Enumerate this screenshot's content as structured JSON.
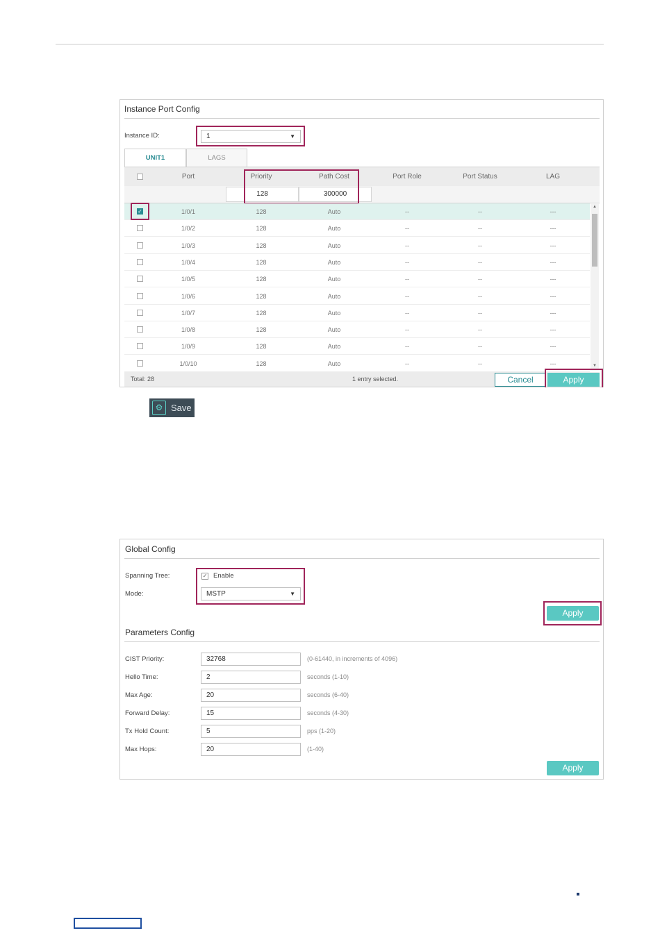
{
  "instance_port_config": {
    "title": "Instance Port Config",
    "instance_id_label": "Instance ID:",
    "instance_id_value": "1",
    "tabs": [
      "UNIT1",
      "LAGS"
    ],
    "columns": [
      "Port",
      "Priority",
      "Path Cost",
      "Port Role",
      "Port Status",
      "LAG"
    ],
    "edit_priority": "128",
    "edit_path_cost": "300000",
    "rows": [
      {
        "port": "1/0/1",
        "priority": "128",
        "path_cost": "Auto",
        "role": "--",
        "status": "--",
        "lag": "---",
        "checked": true
      },
      {
        "port": "1/0/2",
        "priority": "128",
        "path_cost": "Auto",
        "role": "--",
        "status": "--",
        "lag": "---",
        "checked": false
      },
      {
        "port": "1/0/3",
        "priority": "128",
        "path_cost": "Auto",
        "role": "--",
        "status": "--",
        "lag": "---",
        "checked": false
      },
      {
        "port": "1/0/4",
        "priority": "128",
        "path_cost": "Auto",
        "role": "--",
        "status": "--",
        "lag": "---",
        "checked": false
      },
      {
        "port": "1/0/5",
        "priority": "128",
        "path_cost": "Auto",
        "role": "--",
        "status": "--",
        "lag": "---",
        "checked": false
      },
      {
        "port": "1/0/6",
        "priority": "128",
        "path_cost": "Auto",
        "role": "--",
        "status": "--",
        "lag": "---",
        "checked": false
      },
      {
        "port": "1/0/7",
        "priority": "128",
        "path_cost": "Auto",
        "role": "--",
        "status": "--",
        "lag": "---",
        "checked": false
      },
      {
        "port": "1/0/8",
        "priority": "128",
        "path_cost": "Auto",
        "role": "--",
        "status": "--",
        "lag": "---",
        "checked": false
      },
      {
        "port": "1/0/9",
        "priority": "128",
        "path_cost": "Auto",
        "role": "--",
        "status": "--",
        "lag": "---",
        "checked": false
      },
      {
        "port": "1/0/10",
        "priority": "128",
        "path_cost": "Auto",
        "role": "--",
        "status": "--",
        "lag": "---",
        "checked": false
      }
    ],
    "total": "Total: 28",
    "selected": "1 entry selected.",
    "cancel": "Cancel",
    "apply": "Apply"
  },
  "save": {
    "label": "Save"
  },
  "global_config": {
    "title": "Global Config",
    "spanning_tree_label": "Spanning Tree:",
    "enable_label": "Enable",
    "mode_label": "Mode:",
    "mode_value": "MSTP",
    "apply": "Apply"
  },
  "parameters_config": {
    "title": "Parameters Config",
    "fields": [
      {
        "label": "CIST Priority:",
        "value": "32768",
        "hint": "(0-61440, in increments of 4096)"
      },
      {
        "label": "Hello Time:",
        "value": "2",
        "hint": "seconds (1-10)"
      },
      {
        "label": "Max Age:",
        "value": "20",
        "hint": "seconds (6-40)"
      },
      {
        "label": "Forward Delay:",
        "value": "15",
        "hint": "seconds (4-30)"
      },
      {
        "label": "Tx Hold Count:",
        "value": "5",
        "hint": "pps (1-20)"
      },
      {
        "label": "Max Hops:",
        "value": "20",
        "hint": "(1-40)"
      }
    ],
    "apply": "Apply"
  },
  "colors": {
    "accent": "#5ac8c2",
    "highlight": "#a0255a",
    "teal": "#2a8c93"
  }
}
